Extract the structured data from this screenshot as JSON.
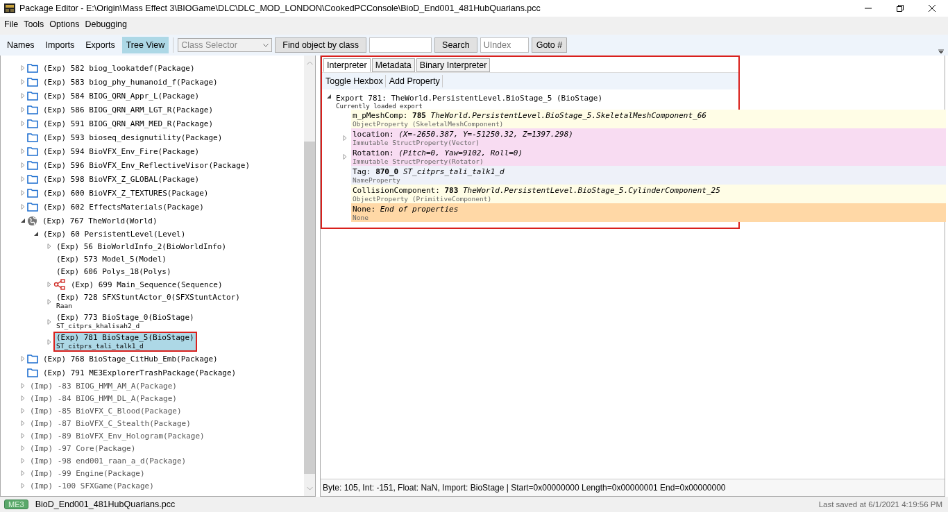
{
  "window": {
    "title": "Package Editor - E:\\Origin\\Mass Effect 3\\BIOGame\\DLC\\DLC_MOD_LONDON\\CookedPCConsole\\BioD_End001_481HubQuarians.pcc"
  },
  "menu": [
    "File",
    "Tools",
    "Options",
    "Debugging"
  ],
  "toolbar": {
    "views": [
      {
        "label": "Names",
        "selected": false
      },
      {
        "label": "Imports",
        "selected": false
      },
      {
        "label": "Exports",
        "selected": false
      },
      {
        "label": "Tree View",
        "selected": true
      }
    ],
    "class_selector": {
      "placeholder": "Class Selector"
    },
    "find_button": "Find object by class",
    "search_button": "Search",
    "uindex_field": {
      "placeholder": "UIndex"
    },
    "goto_button": "Goto #"
  },
  "tree": [
    {
      "prefix": "(Exp)",
      "text": "582 biog_lookatdef(Package)",
      "kind": "package",
      "expanded": false,
      "selected": false
    },
    {
      "prefix": "(Exp)",
      "text": "583 biog_phy_humanoid_f(Package)",
      "kind": "package",
      "expanded": false,
      "selected": false
    },
    {
      "prefix": "(Exp)",
      "text": "584 BIOG_QRN_Appr_L(Package)",
      "kind": "package",
      "expanded": false,
      "selected": false
    },
    {
      "prefix": "(Exp)",
      "text": "586 BIOG_QRN_ARM_LGT_R(Package)",
      "kind": "package",
      "expanded": false,
      "selected": false
    },
    {
      "prefix": "(Exp)",
      "text": "591 BIOG_QRN_ARM_MED_R(Package)",
      "kind": "package",
      "expanded": false,
      "selected": false
    },
    {
      "prefix": "(Exp)",
      "text": "593 bioseq_designutility(Package)",
      "kind": "package",
      "selected": false
    },
    {
      "prefix": "(Exp)",
      "text": "594 BioVFX_Env_Fire(Package)",
      "kind": "package",
      "expanded": false,
      "selected": false
    },
    {
      "prefix": "(Exp)",
      "text": "596 BioVFX_Env_ReflectiveVisor(Package)",
      "kind": "package",
      "expanded": false,
      "selected": false
    },
    {
      "prefix": "(Exp)",
      "text": "598 BioVFX_Z_GLOBAL(Package)",
      "kind": "package",
      "expanded": false,
      "selected": false
    },
    {
      "prefix": "(Exp)",
      "text": "600 BioVFX_Z_TEXTURES(Package)",
      "kind": "package",
      "expanded": false,
      "selected": false
    },
    {
      "prefix": "(Exp)",
      "text": "602 EffectsMaterials(Package)",
      "kind": "package",
      "expanded": false,
      "selected": false
    },
    {
      "prefix": "(Exp)",
      "text": "767 TheWorld(World)",
      "kind": "world",
      "expanded": true,
      "selected": false,
      "children": [
        {
          "prefix": "(Exp)",
          "text": "60 PersistentLevel(Level)",
          "expanded": true,
          "selected": false,
          "children": [
            {
              "prefix": "(Exp)",
              "text": "56 BioWorldInfo_2(BioWorldInfo)",
              "expanded": false,
              "selected": false
            },
            {
              "prefix": "(Exp)",
              "text": "573 Model_5(Model)",
              "selected": false
            },
            {
              "prefix": "(Exp)",
              "text": "606 Polys_18(Polys)",
              "selected": false
            },
            {
              "prefix": "(Exp)",
              "text": "699 Main_Sequence(Sequence)",
              "kind": "sequence",
              "expanded": false,
              "selected": false
            },
            {
              "prefix": "(Exp)",
              "text": "728 SFXStuntActor_0(SFXStuntActor)",
              "subtitle": "Raan",
              "expanded": false,
              "selected": false
            },
            {
              "prefix": "(Exp)",
              "text": "773 BioStage_0(BioStage)",
              "subtitle": "ST_citprs_khalisah2_d",
              "expanded": false,
              "selected": false
            },
            {
              "prefix": "(Exp)",
              "text": "781 BioStage_5(BioStage)",
              "subtitle": "ST_citprs_tali_talk1_d",
              "expanded": false,
              "selected": true,
              "annotated": true
            }
          ]
        }
      ]
    },
    {
      "prefix": "(Exp)",
      "text": "768 BioStage_CitHub_Emb(Package)",
      "kind": "package",
      "expanded": false,
      "selected": false
    },
    {
      "prefix": "(Exp)",
      "text": "791 ME3ExplorerTrashPackage(Package)",
      "kind": "package",
      "selected": false
    },
    {
      "prefix": "(Imp)",
      "text": "-83 BIOG_HMM_AM_A(Package)",
      "expanded": false,
      "selected": false
    },
    {
      "prefix": "(Imp)",
      "text": "-84 BIOG_HMM_DL_A(Package)",
      "expanded": false,
      "selected": false
    },
    {
      "prefix": "(Imp)",
      "text": "-85 BioVFX_C_Blood(Package)",
      "expanded": false,
      "selected": false
    },
    {
      "prefix": "(Imp)",
      "text": "-87 BioVFX_C_Stealth(Package)",
      "expanded": false,
      "selected": false
    },
    {
      "prefix": "(Imp)",
      "text": "-89 BioVFX_Env_Hologram(Package)",
      "expanded": false,
      "selected": false
    },
    {
      "prefix": "(Imp)",
      "text": "-97 Core(Package)",
      "expanded": false,
      "selected": false
    },
    {
      "prefix": "(Imp)",
      "text": "-98 end001_raan_a_d(Package)",
      "expanded": false,
      "selected": false
    },
    {
      "prefix": "(Imp)",
      "text": "-99 Engine(Package)",
      "expanded": false,
      "selected": false
    },
    {
      "prefix": "(Imp)",
      "text": "-100 SFXGame(Package)",
      "expanded": false,
      "selected": false
    }
  ],
  "editor": {
    "annotated": true,
    "tabs": [
      {
        "label": "Interpreter",
        "selected": true
      },
      {
        "label": "Metadata",
        "selected": false
      },
      {
        "label": "Binary Interpreter",
        "selected": false
      }
    ],
    "buttons": [
      "Toggle Hexbox",
      "Add Property"
    ],
    "export": {
      "title": "Export 781: TheWorld.PersistentLevel.BioStage_5 (BioStage)",
      "subtitle": "Currently loaded export",
      "expanded": true
    },
    "properties": [
      {
        "line": "m_pMeshComp: **785** *TheWorld.PersistentLevel.BioStage_5.SkeletalMeshComponent_66*",
        "type": "ObjectProperty (SkeletalMeshComponent)",
        "color": "#fffde6"
      },
      {
        "line": "location: *(X=-2650.387, Y=-51250.32, Z=1397.298)*",
        "type": "Immutable StructProperty(Vector)",
        "color": "#f8dcf2",
        "expanded": false
      },
      {
        "line": "Rotation: *(Pitch=0, Yaw=9102, Roll=0)*",
        "type": "Immutable StructProperty(Rotator)",
        "color": "#f8dcf2",
        "expanded": false
      },
      {
        "line": "Tag: **870_0** *ST_citprs_tali_talk1_d*",
        "type": "NameProperty",
        "color": "#eef1f9"
      },
      {
        "line": "CollisionComponent: **783** *TheWorld.PersistentLevel.BioStage_5.CylinderComponent_25*",
        "type": "ObjectProperty (PrimitiveComponent)",
        "color": "#fffde6"
      },
      {
        "line": "None: *End of properties*",
        "type": "None",
        "color": "#ffd8a6"
      }
    ],
    "info_bar": "Byte: 105, Int: -151, Float: NaN, Import: BioStage | Start=0x00000000 Length=0x00000001 End=0x00000000"
  },
  "status_bar": {
    "badge": "ME3",
    "file": "BioD_End001_481HubQuarians.pcc",
    "saved": "Last saved at 6/1/2021 4:19:56 PM"
  }
}
